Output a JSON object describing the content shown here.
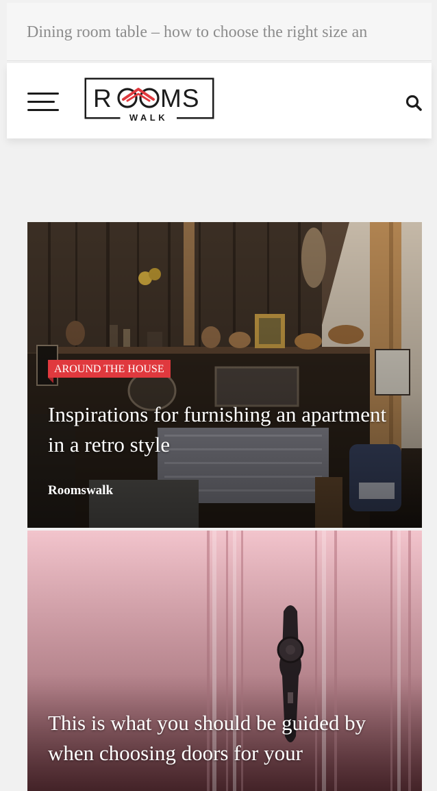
{
  "ticker": {
    "text": "Dining room table – how to choose the right size an"
  },
  "header": {
    "logo": {
      "main": "ROOMS",
      "sub": "WALK"
    },
    "menu_icon": "hamburger-icon",
    "search_icon": "search-icon"
  },
  "posts": [
    {
      "category": "AROUND THE HOUSE",
      "title": "Inspirations for furnishing an apartment in a retro style",
      "author": "Roomswalk"
    },
    {
      "title": "This is what you should be guided by when choosing doors for your"
    }
  ],
  "colors": {
    "accent": "#e0393e",
    "background": "#f1f1f1",
    "ticker_text": "#8c8c8c"
  }
}
